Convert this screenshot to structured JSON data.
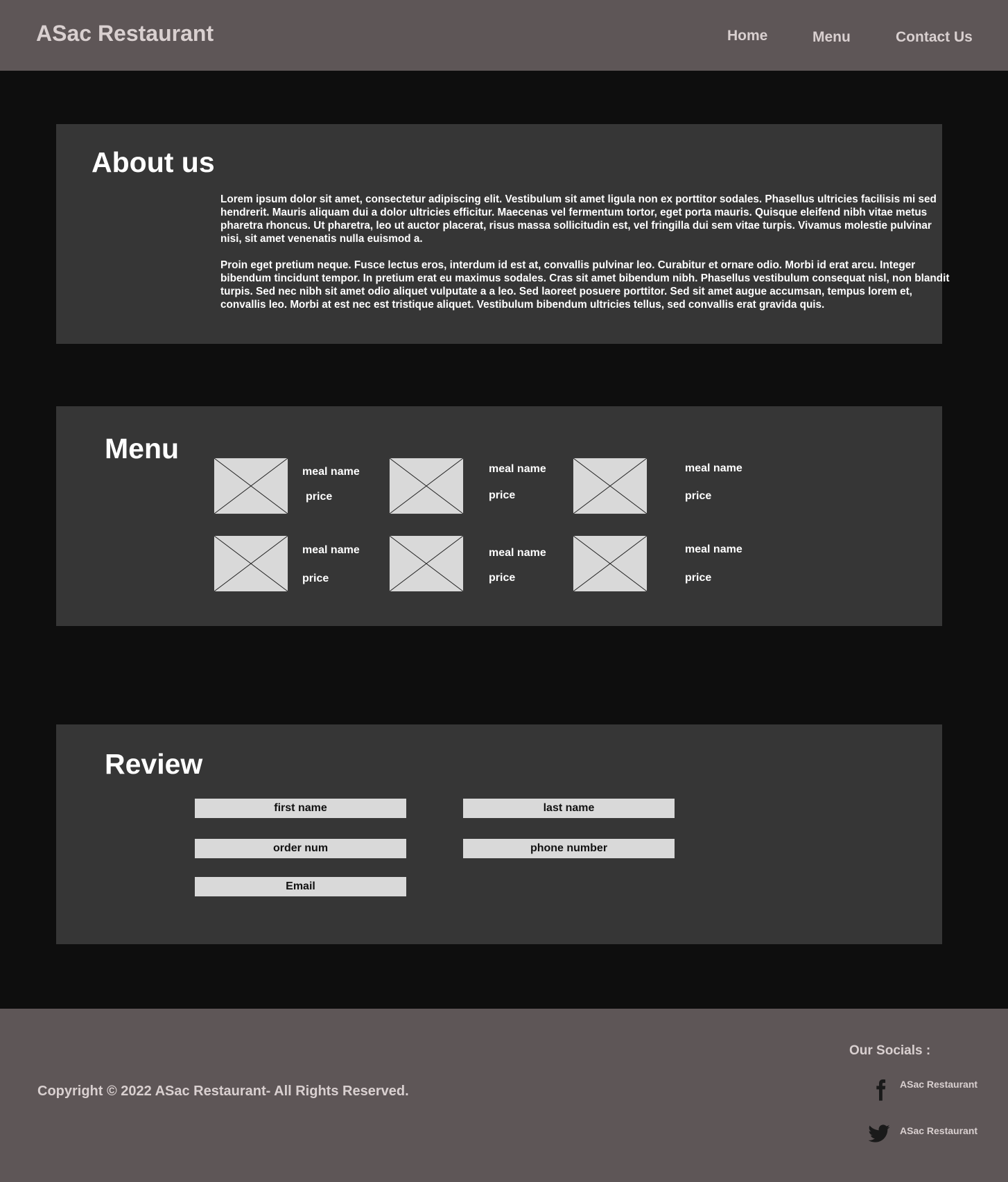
{
  "header": {
    "brand": "ASac Restaurant",
    "nav": [
      "Home",
      "Menu",
      "Contact Us"
    ]
  },
  "about": {
    "title": "About us",
    "paragraphs": [
      "Lorem ipsum dolor sit amet, consectetur adipiscing elit. Vestibulum sit amet ligula non ex porttitor sodales. Phasellus ultricies facilisis mi sed hendrerit. Mauris aliquam dui a dolor ultricies efficitur. Maecenas vel fermentum tortor, eget porta mauris. Quisque eleifend nibh vitae metus pharetra rhoncus. Ut pharetra, leo ut auctor placerat, risus massa sollicitudin est, vel fringilla dui sem vitae turpis. Vivamus molestie pulvinar nisi, sit amet venenatis nulla euismod a.",
      "Proin eget pretium neque. Fusce lectus eros, interdum id est at, convallis pulvinar leo. Curabitur et ornare odio. Morbi id erat arcu. Integer bibendum tincidunt tempor. In pretium erat eu maximus sodales. Cras sit amet bibendum nibh. Phasellus vestibulum consequat nisl, non blandit turpis. Sed nec nibh sit amet odio aliquet vulputate a a leo. Sed laoreet posuere porttitor. Sed sit amet augue accumsan, tempus lorem et, convallis leo. Morbi at est nec est tristique aliquet. Vestibulum bibendum ultricies tellus, sed convallis erat gravida quis."
    ]
  },
  "menu": {
    "title": "Menu",
    "items": [
      {
        "name": "meal name",
        "price": "price"
      },
      {
        "name": "meal name",
        "price": "price"
      },
      {
        "name": "meal name",
        "price": "price"
      },
      {
        "name": "meal name",
        "price": "price"
      },
      {
        "name": "meal name",
        "price": "price"
      },
      {
        "name": "meal name",
        "price": "price"
      }
    ]
  },
  "review": {
    "title": "Review",
    "fields": {
      "first_name": "first name",
      "last_name": "last name",
      "order_num": "order num",
      "phone_number": "phone number",
      "email": "Email"
    }
  },
  "footer": {
    "copyright": "Copyright © 2022 ASac Restaurant- All Rights Reserved.",
    "socials_title": "Our Socials :",
    "socials": [
      {
        "icon": "facebook-icon",
        "label": "ASac Restaurant"
      },
      {
        "icon": "twitter-icon",
        "label": "ASac Restaurant"
      }
    ]
  },
  "colors": {
    "header_footer_bg": "#5e5657",
    "page_bg": "#0e0e0e",
    "panel_bg": "#363636",
    "placeholder_gray": "#d9d9d9",
    "nav_text": "#d9d0d0"
  }
}
